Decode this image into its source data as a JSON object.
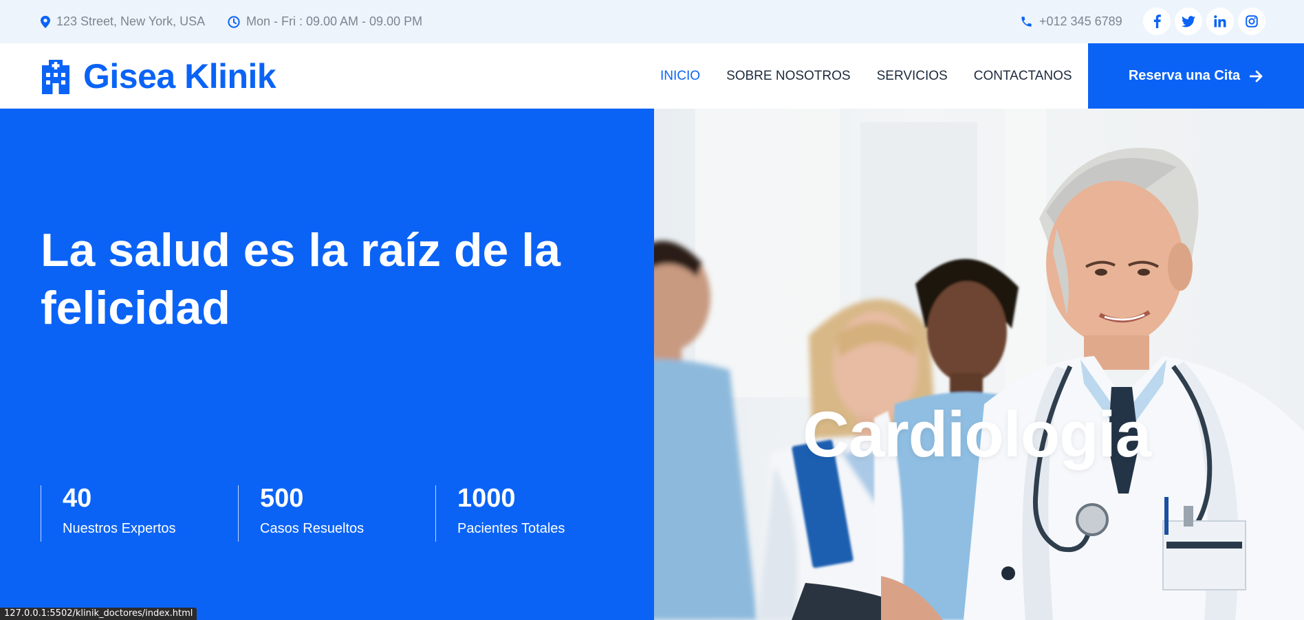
{
  "topbar": {
    "address": "123 Street, New York, USA",
    "hours": "Mon - Fri : 09.00 AM - 09.00 PM",
    "phone": "+012 345 6789",
    "socials": [
      "facebook-icon",
      "twitter-icon",
      "linkedin-icon",
      "instagram-icon"
    ]
  },
  "navbar": {
    "brand": "Gisea Klinik",
    "links": [
      {
        "label": "INICIO",
        "active": true
      },
      {
        "label": "SOBRE NOSOTROS",
        "active": false
      },
      {
        "label": "SERVICIOS",
        "active": false
      },
      {
        "label": "CONTACTANOS",
        "active": false
      }
    ],
    "cta": "Reserva una Cita"
  },
  "hero": {
    "title": "La salud es la raíz de la felicidad",
    "stats": [
      {
        "value": "40",
        "label": "Nuestros Expertos"
      },
      {
        "value": "500",
        "label": "Casos Resueltos"
      },
      {
        "value": "1000",
        "label": "Pacientes Totales"
      }
    ],
    "slide_text": "Cardiologia"
  },
  "status_url": "127.0.0.1:5502/klinik_doctores/index.html",
  "colors": {
    "primary": "#0b63f6",
    "topbar_bg": "#eef4fc",
    "nav_text": "#1b2a3d",
    "muted": "#7b8591"
  }
}
